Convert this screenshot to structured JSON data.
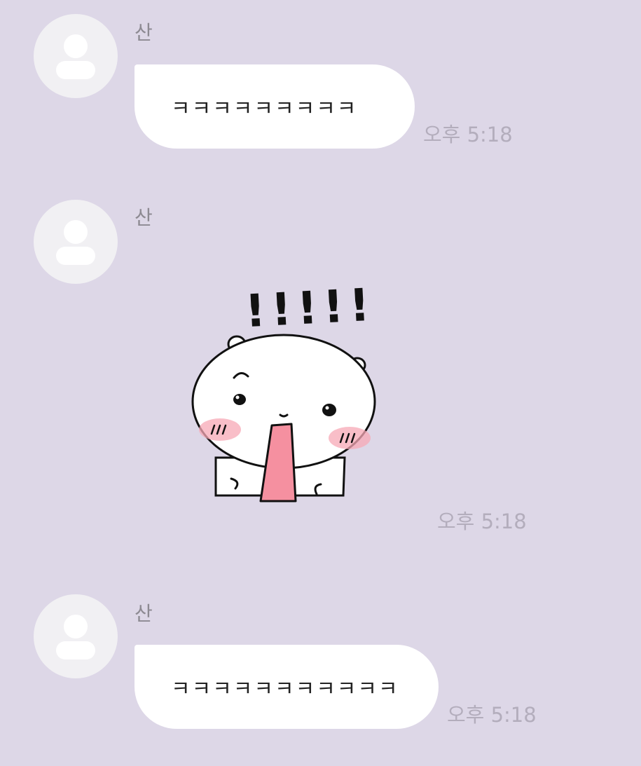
{
  "chat": {
    "background_color": "#ddd7e7",
    "messages": [
      {
        "sender": "산",
        "type": "text",
        "text": "ㅋㅋㅋㅋㅋㅋㅋㅋㅋ",
        "time": "오후 5:18"
      },
      {
        "sender": "산",
        "type": "sticker",
        "sticker_text": "!!!!!",
        "time": "오후 5:18"
      },
      {
        "sender": "산",
        "type": "text",
        "text": "ㅋㅋㅋㅋㅋㅋㅋㅋㅋㅋㅋ",
        "time": "오후 5:18"
      }
    ]
  },
  "icons": {
    "avatar": "default-profile-icon",
    "sticker": "hamster-sticker"
  }
}
